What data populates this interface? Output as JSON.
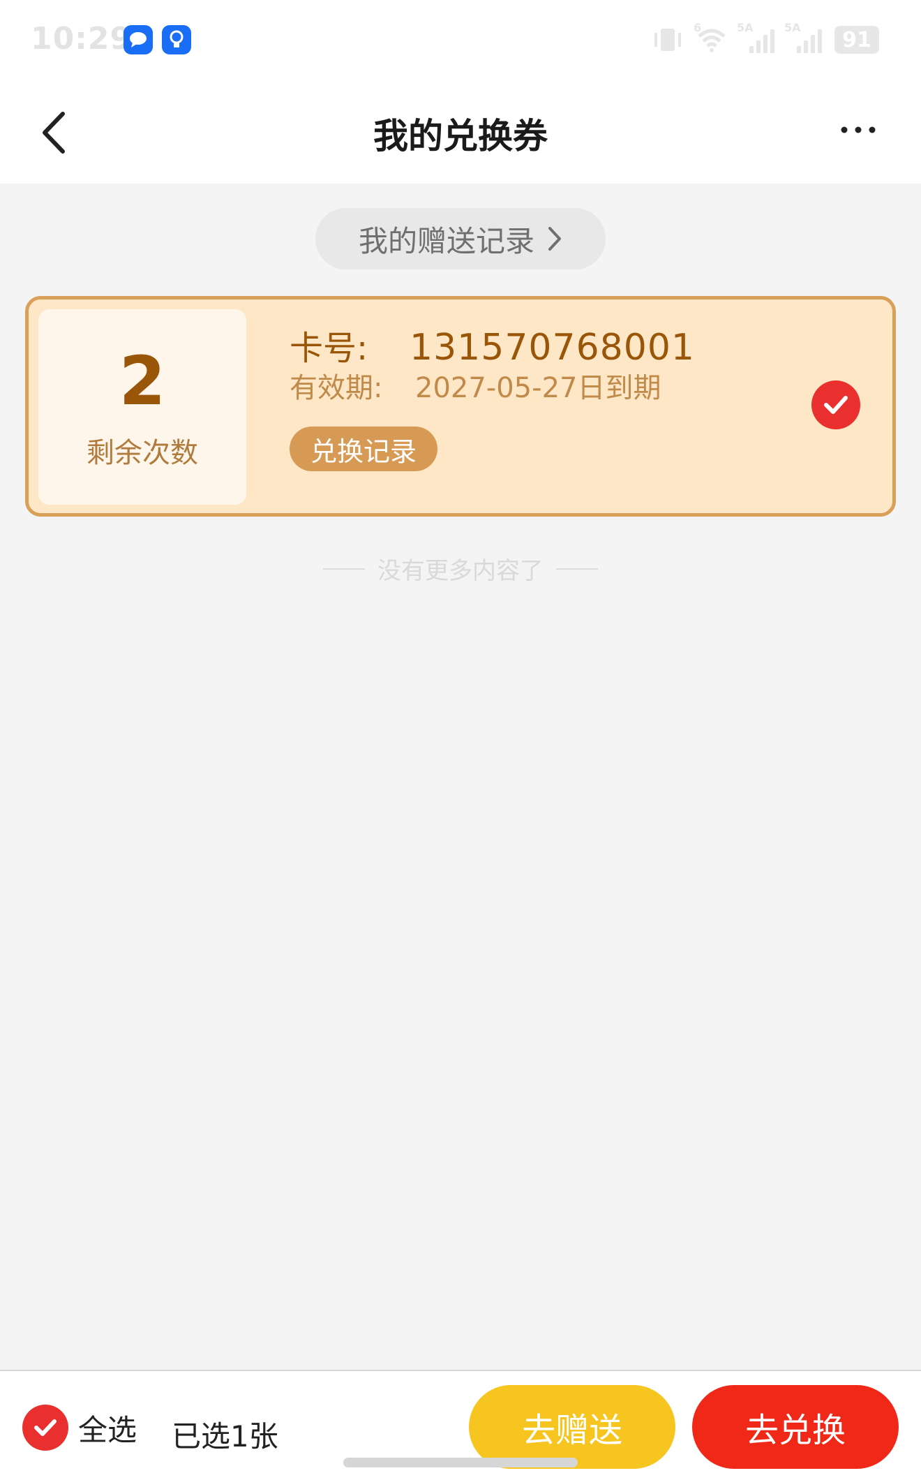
{
  "status_bar": {
    "time": "10:29",
    "network_tags": [
      "6",
      "5A",
      "5A"
    ],
    "battery": "91"
  },
  "header": {
    "title": "我的兑换券"
  },
  "gift_record_link": {
    "label": "我的赠送记录"
  },
  "voucher": {
    "remaining_count": "2",
    "remaining_label": "剩余次数",
    "card_no_label": "卡号:",
    "card_no": "131570768001",
    "expiry_label": "有效期:",
    "expiry": "2027-05-27日到期",
    "redeem_record_label": "兑换记录",
    "selected": true
  },
  "list_end_text": "没有更多内容了",
  "footer": {
    "select_all_label": "全选",
    "selected_count_text": "已选1张",
    "gift_button_label": "去赠送",
    "redeem_button_label": "去兑换"
  },
  "colors": {
    "accent_red": "#f02818",
    "gift_yellow": "#f7c51f",
    "card_bg": "#fde7c7",
    "card_border": "#d9a05a",
    "card_text": "#9a5608"
  }
}
